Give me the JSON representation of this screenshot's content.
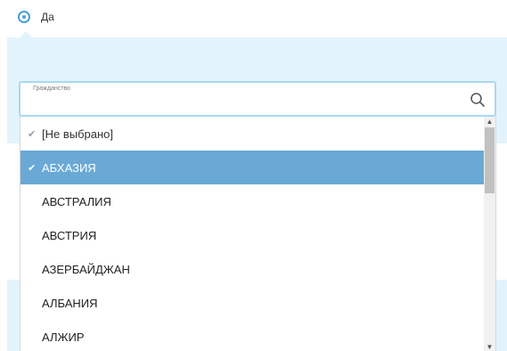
{
  "radio": {
    "label": "Да",
    "checked": true
  },
  "citizenship": {
    "label": "Гражданство",
    "value": "",
    "placeholder": "",
    "search_icon": "search-icon"
  },
  "options": [
    {
      "label": "[Не выбрано]",
      "state": "placeholder"
    },
    {
      "label": "АБХАЗИЯ",
      "state": "selected"
    },
    {
      "label": "АВСТРАЛИЯ",
      "state": "normal"
    },
    {
      "label": "АВСТРИЯ",
      "state": "normal"
    },
    {
      "label": "АЗЕРБАЙДЖАН",
      "state": "normal"
    },
    {
      "label": "АЛБАНИЯ",
      "state": "normal"
    },
    {
      "label": "АЛЖИР",
      "state": "normal"
    }
  ],
  "colors": {
    "accent": "#4a9fd8",
    "panel_bg": "#e3f3fc",
    "selected_bg": "#6aa9d6",
    "field_border": "#a8d8f2"
  },
  "icons": {
    "check": "✔",
    "scroll_up": "▲",
    "scroll_down": "▼"
  }
}
